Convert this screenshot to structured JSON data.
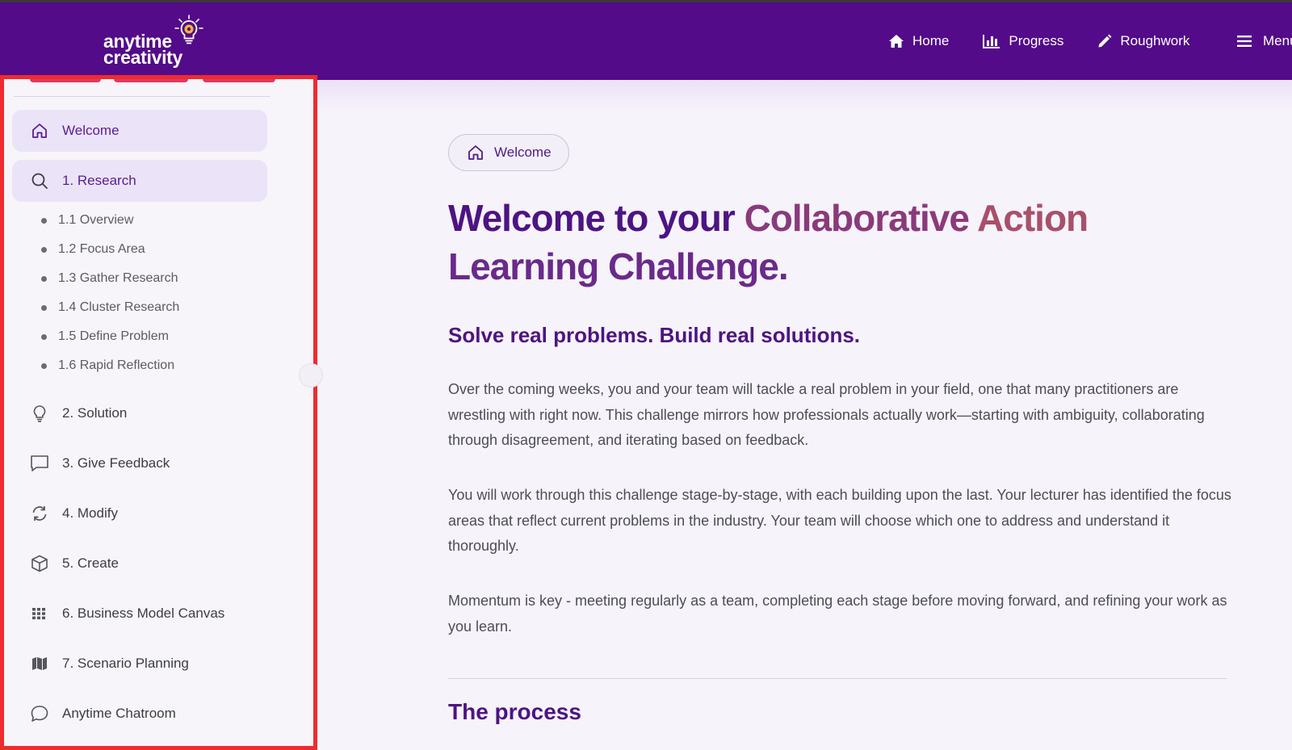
{
  "brand": {
    "line1": "anytime",
    "line2": "creativity"
  },
  "nav": {
    "home": "Home",
    "progress": "Progress",
    "roughwork": "Roughwork",
    "menu": "Menu"
  },
  "sidebar": {
    "items": [
      {
        "label": "Welcome",
        "icon": "home-icon",
        "active": true
      },
      {
        "label": "1. Research",
        "icon": "search-icon",
        "active": true
      },
      {
        "label": "2. Solution",
        "icon": "lightbulb-icon"
      },
      {
        "label": "3. Give Feedback",
        "icon": "message-square-icon"
      },
      {
        "label": "4. Modify",
        "icon": "refresh-icon"
      },
      {
        "label": "5. Create",
        "icon": "cube-icon"
      },
      {
        "label": "6. Business Model Canvas",
        "icon": "grid-icon"
      },
      {
        "label": "7. Scenario Planning",
        "icon": "map-icon"
      },
      {
        "label": "Anytime Chatroom",
        "icon": "chat-bubble-icon"
      }
    ],
    "research_sub": [
      "1.1 Overview",
      "1.2 Focus Area",
      "1.3 Gather Research",
      "1.4 Cluster Research",
      "1.5 Define Problem",
      "1.6 Rapid Reflection"
    ]
  },
  "main": {
    "chip": "Welcome",
    "title_a": "Welcome to your ",
    "title_b": "Collaborative ",
    "title_c": "Action",
    "title_d": "Learning Challenge.",
    "subtitle": "Solve real problems. Build real solutions.",
    "p1": "Over the coming weeks, you and your team will tackle a real problem in your field, one that many practitioners are wrestling with right now. This challenge mirrors how professionals actually work—starting with ambiguity, collaborating through disagreement, and iterating based on feedback.",
    "p2": "You will work through this challenge stage-by-stage, with each building upon the last. Your lecturer has identified the focus areas that reflect current problems in the industry. Your team will choose which one to address and understand it thoroughly.",
    "p3": "Momentum is key - meeting regularly as a team, completing each stage before moving forward, and refining your work as you learn.",
    "process": "The process"
  },
  "colors": {
    "nav_bg": "#530b89",
    "accent": "#4d1482",
    "highlight_border": "#ee2b2f",
    "active_item_bg": "#ebe3f8"
  }
}
